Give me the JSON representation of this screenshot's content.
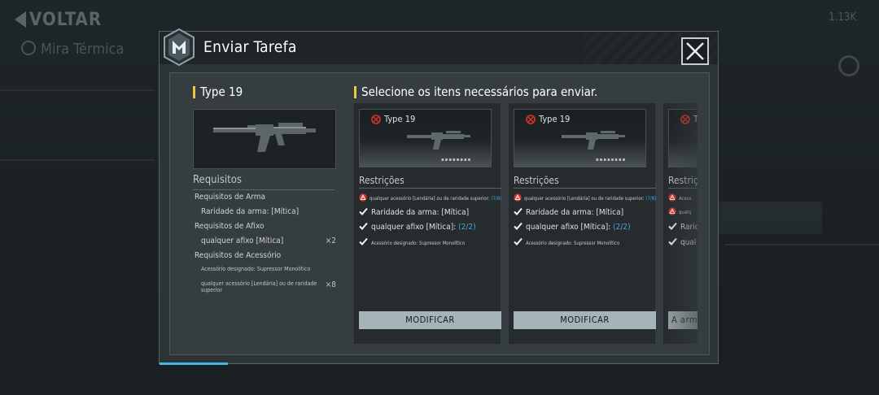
{
  "background": {
    "back_label": "VOLTAR",
    "subtitle": "Mira Térmica",
    "resource_label": "1.13K"
  },
  "modal": {
    "title": "Enviar Tarefa",
    "left": {
      "weapon_name": "Type 19",
      "requirements_title": "Requisitos",
      "rows": [
        {
          "kind": "cat",
          "text": "Requisitos de Arma",
          "mult": ""
        },
        {
          "kind": "item",
          "text": "Raridade da arma: [Mítica]",
          "mult": ""
        },
        {
          "kind": "cat",
          "text": "Requisitos de Afixo",
          "mult": ""
        },
        {
          "kind": "item",
          "text": "qualquer afixo [Mítica]",
          "mult": "×2"
        },
        {
          "kind": "cat",
          "text": "Requisitos de Acessório",
          "mult": ""
        },
        {
          "kind": "small",
          "text": "Acessório designado: Supressor Monolítico",
          "mult": ""
        },
        {
          "kind": "small",
          "text": "qualquer acessório [Lendária] ou de raridade superior",
          "mult": "×8"
        }
      ]
    },
    "right_title": "Selecione os itens necessários para enviar.",
    "cards": [
      {
        "name": "Type 19",
        "pips": "▪▪▪▪▪▪▪▪",
        "restrictions_title": "Restrições",
        "lines": [
          {
            "icon": "warn",
            "text": "qualquer acessório [Lendária] ou de raridade superior:",
            "suffix": "(7/8)",
            "tiny": true
          },
          {
            "icon": "check",
            "text": "Raridade da arma: [Mítica]",
            "suffix": "",
            "tiny": false
          },
          {
            "icon": "check",
            "text": "qualquer afixo [Mítica]:",
            "suffix": "(2/2)",
            "tiny": false
          },
          {
            "icon": "check",
            "text": "Acessório designado: Supressor Monolítico",
            "suffix": "",
            "tiny": true
          }
        ],
        "button": "MODIFICAR"
      },
      {
        "name": "Type 19",
        "pips": "▪▪▪▪▪▪▪▪",
        "restrictions_title": "Restrições",
        "lines": [
          {
            "icon": "warn",
            "text": "qualquer acessório [Lendária] ou de raridade superior:",
            "suffix": "(7/8)",
            "tiny": true
          },
          {
            "icon": "check",
            "text": "Raridade da arma: [Mítica]",
            "suffix": "",
            "tiny": false
          },
          {
            "icon": "check",
            "text": "qualquer afixo [Mítica]:",
            "suffix": "(2/2)",
            "tiny": false
          },
          {
            "icon": "check",
            "text": "Acessório designado: Supressor Monolítico",
            "suffix": "",
            "tiny": true
          }
        ],
        "button": "MODIFICAR"
      },
      {
        "name": "T",
        "pips": "",
        "restrictions_title": "Restriç",
        "lines": [
          {
            "icon": "warn",
            "text": "Acess",
            "suffix": "",
            "tiny": true
          },
          {
            "icon": "warn",
            "text": "qualq",
            "suffix": "",
            "tiny": true
          },
          {
            "icon": "check",
            "text": "Rarid",
            "suffix": "",
            "tiny": false
          },
          {
            "icon": "check",
            "text": "qual",
            "suffix": "",
            "tiny": false
          }
        ],
        "button": "A arma"
      }
    ]
  },
  "colors": {
    "accent_yellow": "#e6c84a",
    "accent_blue": "#4aa3dc",
    "warn_red": "#d9342b",
    "button_bg": "#a6b4ba"
  },
  "icons": {
    "logo": "m-logo-icon",
    "close": "close-icon",
    "warn": "warning-icon",
    "check": "check-icon",
    "rarity": "rarity-mark-icon"
  }
}
